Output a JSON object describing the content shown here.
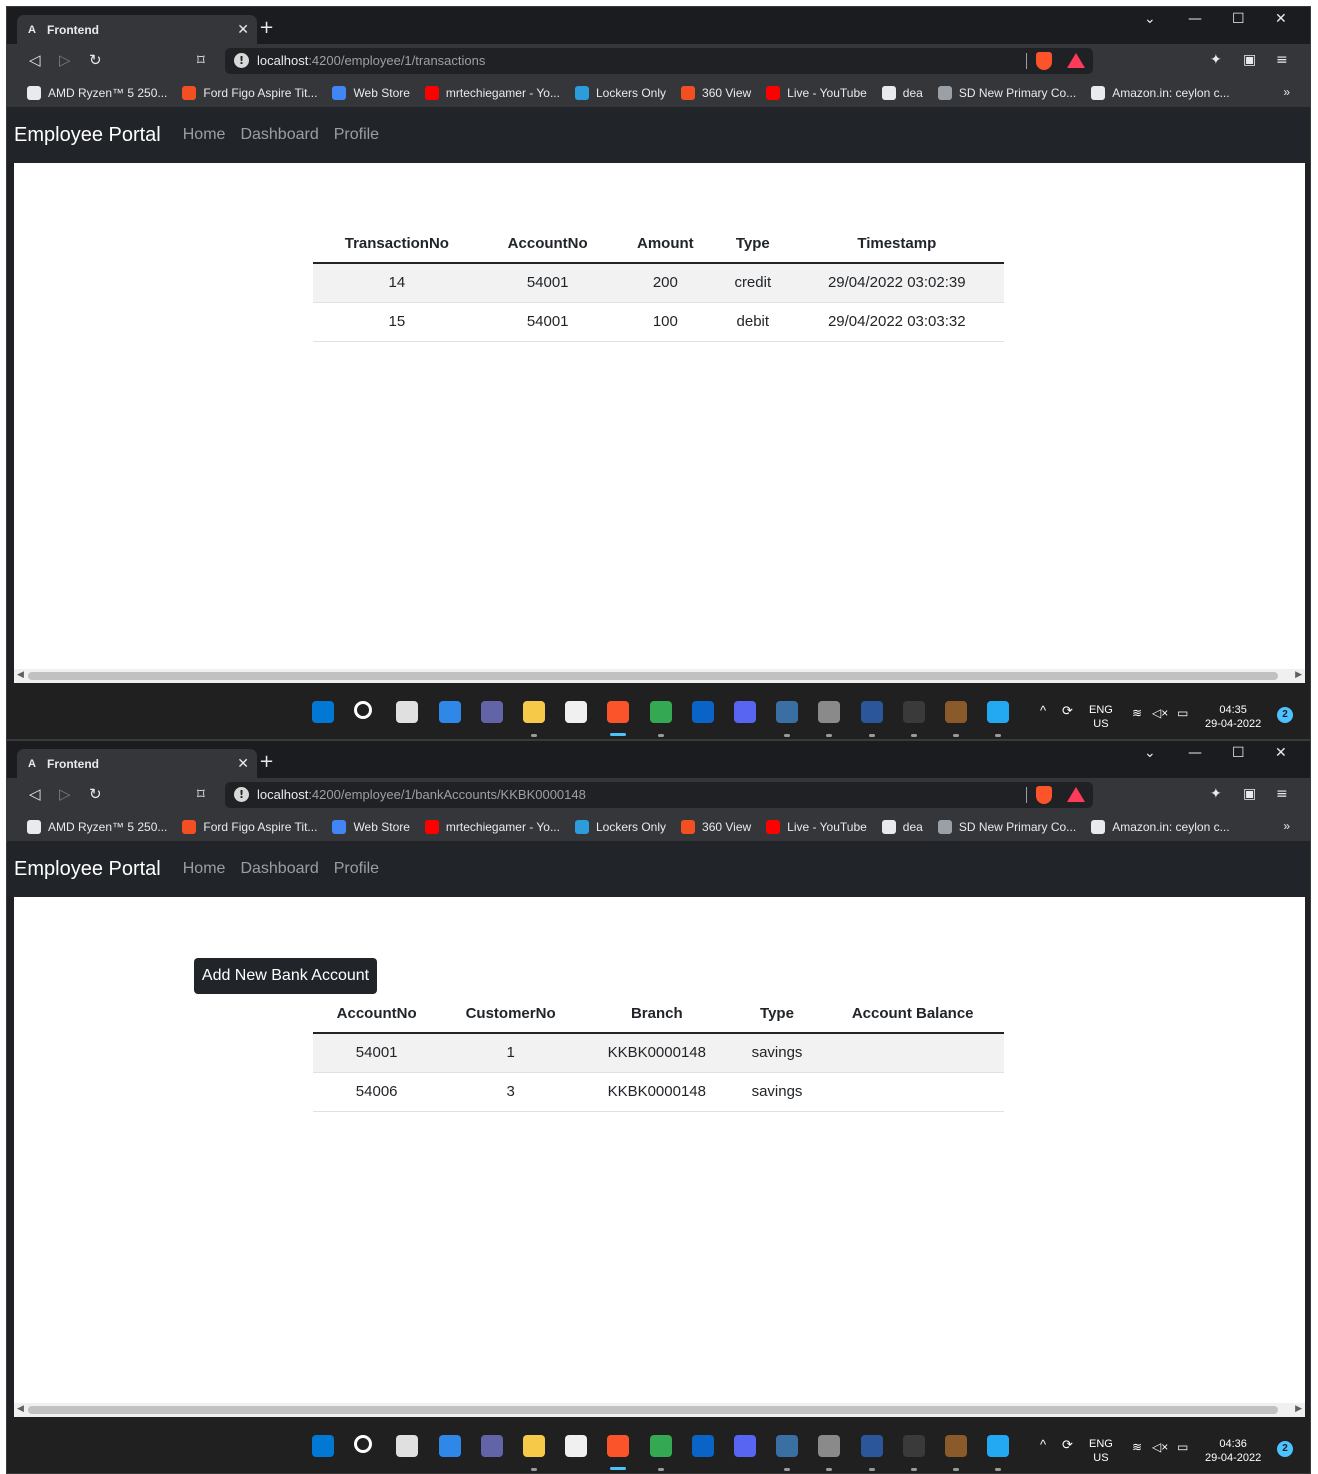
{
  "browser": {
    "tab_title": "Frontend",
    "tab_favicon": "A",
    "bookmarks": [
      {
        "label": "AMD Ryzen™ 5 250...",
        "icon": "amd-icon",
        "color": "#e8eaed"
      },
      {
        "label": "Ford Figo Aspire Tit...",
        "icon": "ford-icon",
        "color": "#f25022"
      },
      {
        "label": "Web Store",
        "icon": "webstore-icon",
        "color": "#4285f4"
      },
      {
        "label": "mrtechiegamer - Yo...",
        "icon": "youtube-icon",
        "color": "#ff0000"
      },
      {
        "label": "Lockers Only",
        "icon": "lockers-icon",
        "color": "#2d9cdb"
      },
      {
        "label": "360 View",
        "icon": "360-icon",
        "color": "#f25022"
      },
      {
        "label": "Live - YouTube",
        "icon": "youtube-icon",
        "color": "#ff0000"
      },
      {
        "label": "dea",
        "icon": "dea-icon",
        "color": "#e8eaed"
      },
      {
        "label": "SD New Primary Co...",
        "icon": "globe-icon",
        "color": "#9aa0a6"
      },
      {
        "label": "Amazon.in: ceylon c...",
        "icon": "amazon-icon",
        "color": "#e8eaed"
      }
    ],
    "bookmarks_more": "»"
  },
  "app": {
    "brand": "Employee Portal",
    "nav": [
      "Home",
      "Dashboard",
      "Profile"
    ]
  },
  "screen1": {
    "url_host": "localhost",
    "url_path": ":4200/employee/1/transactions",
    "columns": [
      "TransactionNo",
      "AccountNo",
      "Amount",
      "Type",
      "Timestamp"
    ],
    "rows": [
      [
        "14",
        "54001",
        "200",
        "credit",
        "29/04/2022 03:02:39"
      ],
      [
        "15",
        "54001",
        "100",
        "debit",
        "29/04/2022 03:03:32"
      ]
    ],
    "clock_time": "04:35",
    "clock_date": "29-04-2022"
  },
  "screen2": {
    "url_host": "localhost",
    "url_path": ":4200/employee/1/bankAccounts/KKBK0000148",
    "add_button": "Add New Bank Account",
    "columns": [
      "AccountNo",
      "CustomerNo",
      "Branch",
      "Type",
      "Account Balance"
    ],
    "rows": [
      [
        "54001",
        "1",
        "KKBK0000148",
        "savings",
        ""
      ],
      [
        "54006",
        "3",
        "KKBK0000148",
        "savings",
        ""
      ]
    ],
    "clock_time": "04:36",
    "clock_date": "29-04-2022"
  },
  "taskbar": {
    "lang": "ENG",
    "region": "US",
    "notification_count": "2",
    "apps": [
      {
        "name": "start-icon",
        "color": "#0078d4"
      },
      {
        "name": "search-icon",
        "color": "#ffffff"
      },
      {
        "name": "taskview-icon",
        "color": "#e0e0e0"
      },
      {
        "name": "widgets-icon",
        "color": "#2f88e8"
      },
      {
        "name": "teams-chat-icon",
        "color": "#6264a7"
      },
      {
        "name": "file-explorer-icon",
        "color": "#f7c948"
      },
      {
        "name": "ms-store-icon",
        "color": "#f0f0f0"
      },
      {
        "name": "brave-icon",
        "color": "#fb542b"
      },
      {
        "name": "chrome-icon",
        "color": "#34a853"
      },
      {
        "name": "mail-icon",
        "color": "#0a64c8"
      },
      {
        "name": "discord-icon",
        "color": "#5865f2"
      },
      {
        "name": "mysql-workbench-icon",
        "color": "#3a6fa3"
      },
      {
        "name": "app-icon",
        "color": "#8a8a8a"
      },
      {
        "name": "word-icon",
        "color": "#2b579a"
      },
      {
        "name": "terminal-icon",
        "color": "#3a3a3a"
      },
      {
        "name": "game-icon",
        "color": "#8b5a2b"
      },
      {
        "name": "vscode-icon",
        "color": "#23a9f2"
      }
    ]
  }
}
